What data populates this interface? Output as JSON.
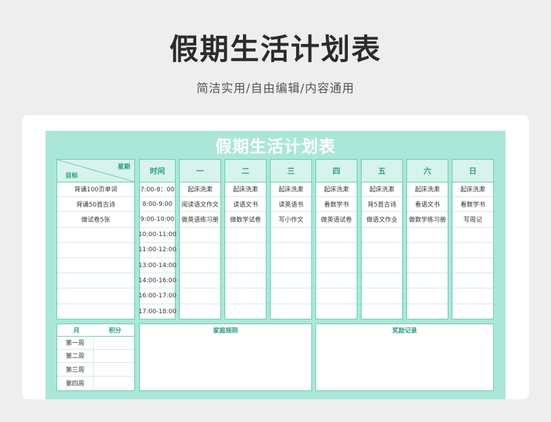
{
  "header": {
    "title": "假期生活计划表",
    "subtitle": "简洁实用/自由编辑/内容通用"
  },
  "sheet": {
    "title": "假期生活计划表",
    "corner": {
      "week": "星期",
      "goal": "目标"
    },
    "goals": [
      "背诵100页单词",
      "背诵50首古诗",
      "做试卷5张",
      "",
      "",
      "",
      "",
      "",
      ""
    ],
    "time_header": "时间",
    "times": [
      "7:00-8：00",
      "8:00-9:00",
      "9:00-10:00",
      "10:00-11:00",
      "11:00-12:00",
      "13:00-14:00",
      "14:00-16:00",
      "16:00-17:00",
      "17:00-18:00"
    ],
    "days": [
      {
        "label": "一",
        "tasks": [
          "起床洗漱",
          "阅读语文作文",
          "做英语练习册",
          "",
          "",
          "",
          "",
          "",
          ""
        ]
      },
      {
        "label": "二",
        "tasks": [
          "起床洗漱",
          "读语文书",
          "做数学试卷",
          "",
          "",
          "",
          "",
          "",
          ""
        ]
      },
      {
        "label": "三",
        "tasks": [
          "起床洗漱",
          "读英语书",
          "写小作文",
          "",
          "",
          "",
          "",
          "",
          ""
        ]
      },
      {
        "label": "四",
        "tasks": [
          "起床洗漱",
          "看数学书",
          "做英语试卷",
          "",
          "",
          "",
          "",
          "",
          ""
        ]
      },
      {
        "label": "五",
        "tasks": [
          "起床洗漱",
          "背5首古诗",
          "做语文作业",
          "",
          "",
          "",
          "",
          "",
          ""
        ]
      },
      {
        "label": "六",
        "tasks": [
          "起床洗漱",
          "看语文书",
          "做数学练习册",
          "",
          "",
          "",
          "",
          "",
          ""
        ]
      },
      {
        "label": "日",
        "tasks": [
          "起床洗漱",
          "看数学书",
          "写周记",
          "",
          "",
          "",
          "",
          "",
          ""
        ]
      }
    ],
    "score_table": {
      "month_label": "月",
      "score_label": "积分",
      "weeks": [
        "第一周",
        "第二周",
        "第三周",
        "第四周"
      ]
    },
    "family_rules_title": "家庭规则",
    "rewards_title": "奖励记录"
  }
}
